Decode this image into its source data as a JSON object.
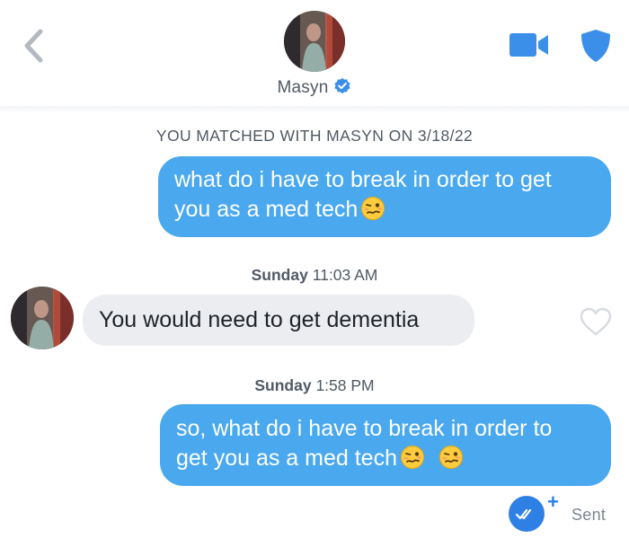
{
  "header": {
    "name": "Masyn",
    "back_icon": "chevron-left-icon",
    "video_icon": "video-camera-icon",
    "safety_icon": "shield-icon",
    "verified_icon": "verified-badge-icon",
    "accent_color": "#3b8fe9"
  },
  "conversation": {
    "match_banner": "YOU MATCHED WITH MASYN ON 3/18/22",
    "messages": [
      {
        "direction": "outgoing",
        "line1": "what do i have to break in order to get",
        "line2": "you as a med tech",
        "emoji": [
          "woozy-face-emoji"
        ]
      },
      {
        "timestamp_day": "Sunday",
        "timestamp_time": "11:03 AM"
      },
      {
        "direction": "incoming",
        "text": "You would need to get dementia",
        "reaction_icon": "heart-outline-icon"
      },
      {
        "timestamp_day": "Sunday",
        "timestamp_time": "1:58 PM"
      },
      {
        "direction": "outgoing",
        "line1": "so, what do i have to break in order to",
        "line2": "get you as a med tech",
        "emoji": [
          "woozy-face-emoji",
          "woozy-face-emoji"
        ]
      }
    ],
    "status": {
      "read_icon": "double-check-icon",
      "plus": "+",
      "label": "Sent"
    }
  },
  "colors": {
    "outgoing_bubble": "#4aa8ef",
    "incoming_bubble": "#ebedf0",
    "secondary_text": "#505965"
  }
}
